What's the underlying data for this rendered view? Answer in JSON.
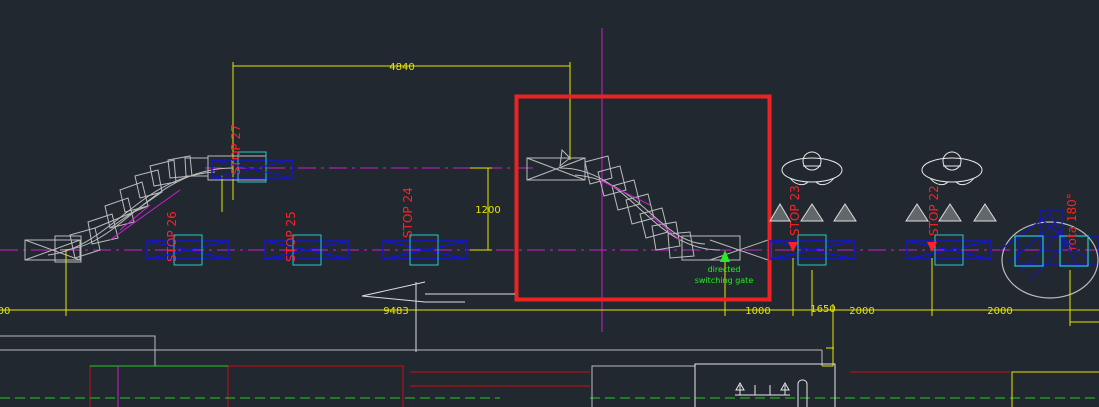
{
  "colors": {
    "background": "#212830",
    "dimension": "#e6e600",
    "centerline": "#cc22cc",
    "stop_text": "#ff2222",
    "station": "#1515cc",
    "carrier": "#22cccc",
    "track": "#bcbcbc",
    "selection": "#ee2222",
    "note": "#22ee22"
  },
  "dimensions": {
    "top": "4840",
    "vertical": "1200",
    "bottom_left_edge": "00",
    "bottom_main": "9483",
    "bottom_1000": "1000",
    "bottom_1650": "1650",
    "bottom_2000_a": "2000",
    "bottom_2000_b": "2000"
  },
  "stops": [
    {
      "id": "stop27",
      "label": "STOP 27"
    },
    {
      "id": "stop25",
      "label": "STOP 25"
    },
    {
      "id": "stop24",
      "label": "STOP 24"
    },
    {
      "id": "stop23",
      "label": "STOP 23"
    },
    {
      "id": "stop22",
      "label": "STOP 22"
    }
  ],
  "rotation_label": "rota 180°",
  "switching_gate_note": {
    "line1": "directed",
    "line2": "switching gate"
  },
  "icons": [
    "operator-icon",
    "warning-triangle-icon",
    "arrow-left-icon"
  ]
}
